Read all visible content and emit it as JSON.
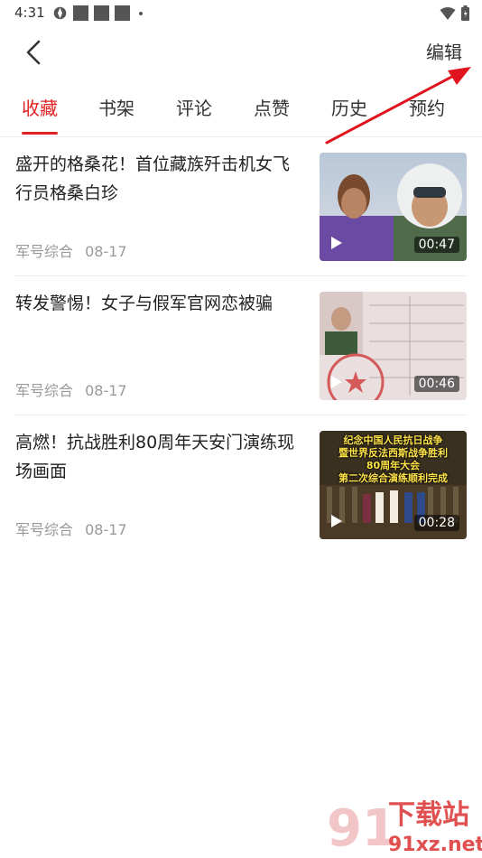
{
  "status_bar": {
    "time": "4:31"
  },
  "header": {
    "edit_label": "编辑"
  },
  "tabs": [
    {
      "label": "收藏",
      "active": true
    },
    {
      "label": "书架",
      "active": false
    },
    {
      "label": "评论",
      "active": false
    },
    {
      "label": "点赞",
      "active": false
    },
    {
      "label": "历史",
      "active": false
    },
    {
      "label": "预约",
      "active": false
    }
  ],
  "items": [
    {
      "title": "盛开的格桑花！首位藏族歼击机女飞行员格桑白珍",
      "source": "军号综合",
      "date": "08-17",
      "duration": "00:47",
      "thumb_icon": "play-icon"
    },
    {
      "title": "转发警惕！女子与假军官网恋被骗",
      "source": "军号综合",
      "date": "08-17",
      "duration": "00:46",
      "thumb_icon": "play-icon"
    },
    {
      "title": "高燃！抗战胜利80周年天安门演练现场画面",
      "source": "军号综合",
      "date": "08-17",
      "duration": "00:28",
      "thumb_icon": "play-icon",
      "poster_lines": [
        "纪念中国人民抗日战争",
        "暨世界反法西斯战争胜利",
        "80周年大会",
        "第二次综合演练顺利完成"
      ]
    }
  ],
  "watermark": {
    "text_top": "下载站",
    "text_bottom": "91xz.net",
    "logo": "91"
  },
  "colors": {
    "accent": "#e22222",
    "annotation_arrow": "#e0141e"
  }
}
